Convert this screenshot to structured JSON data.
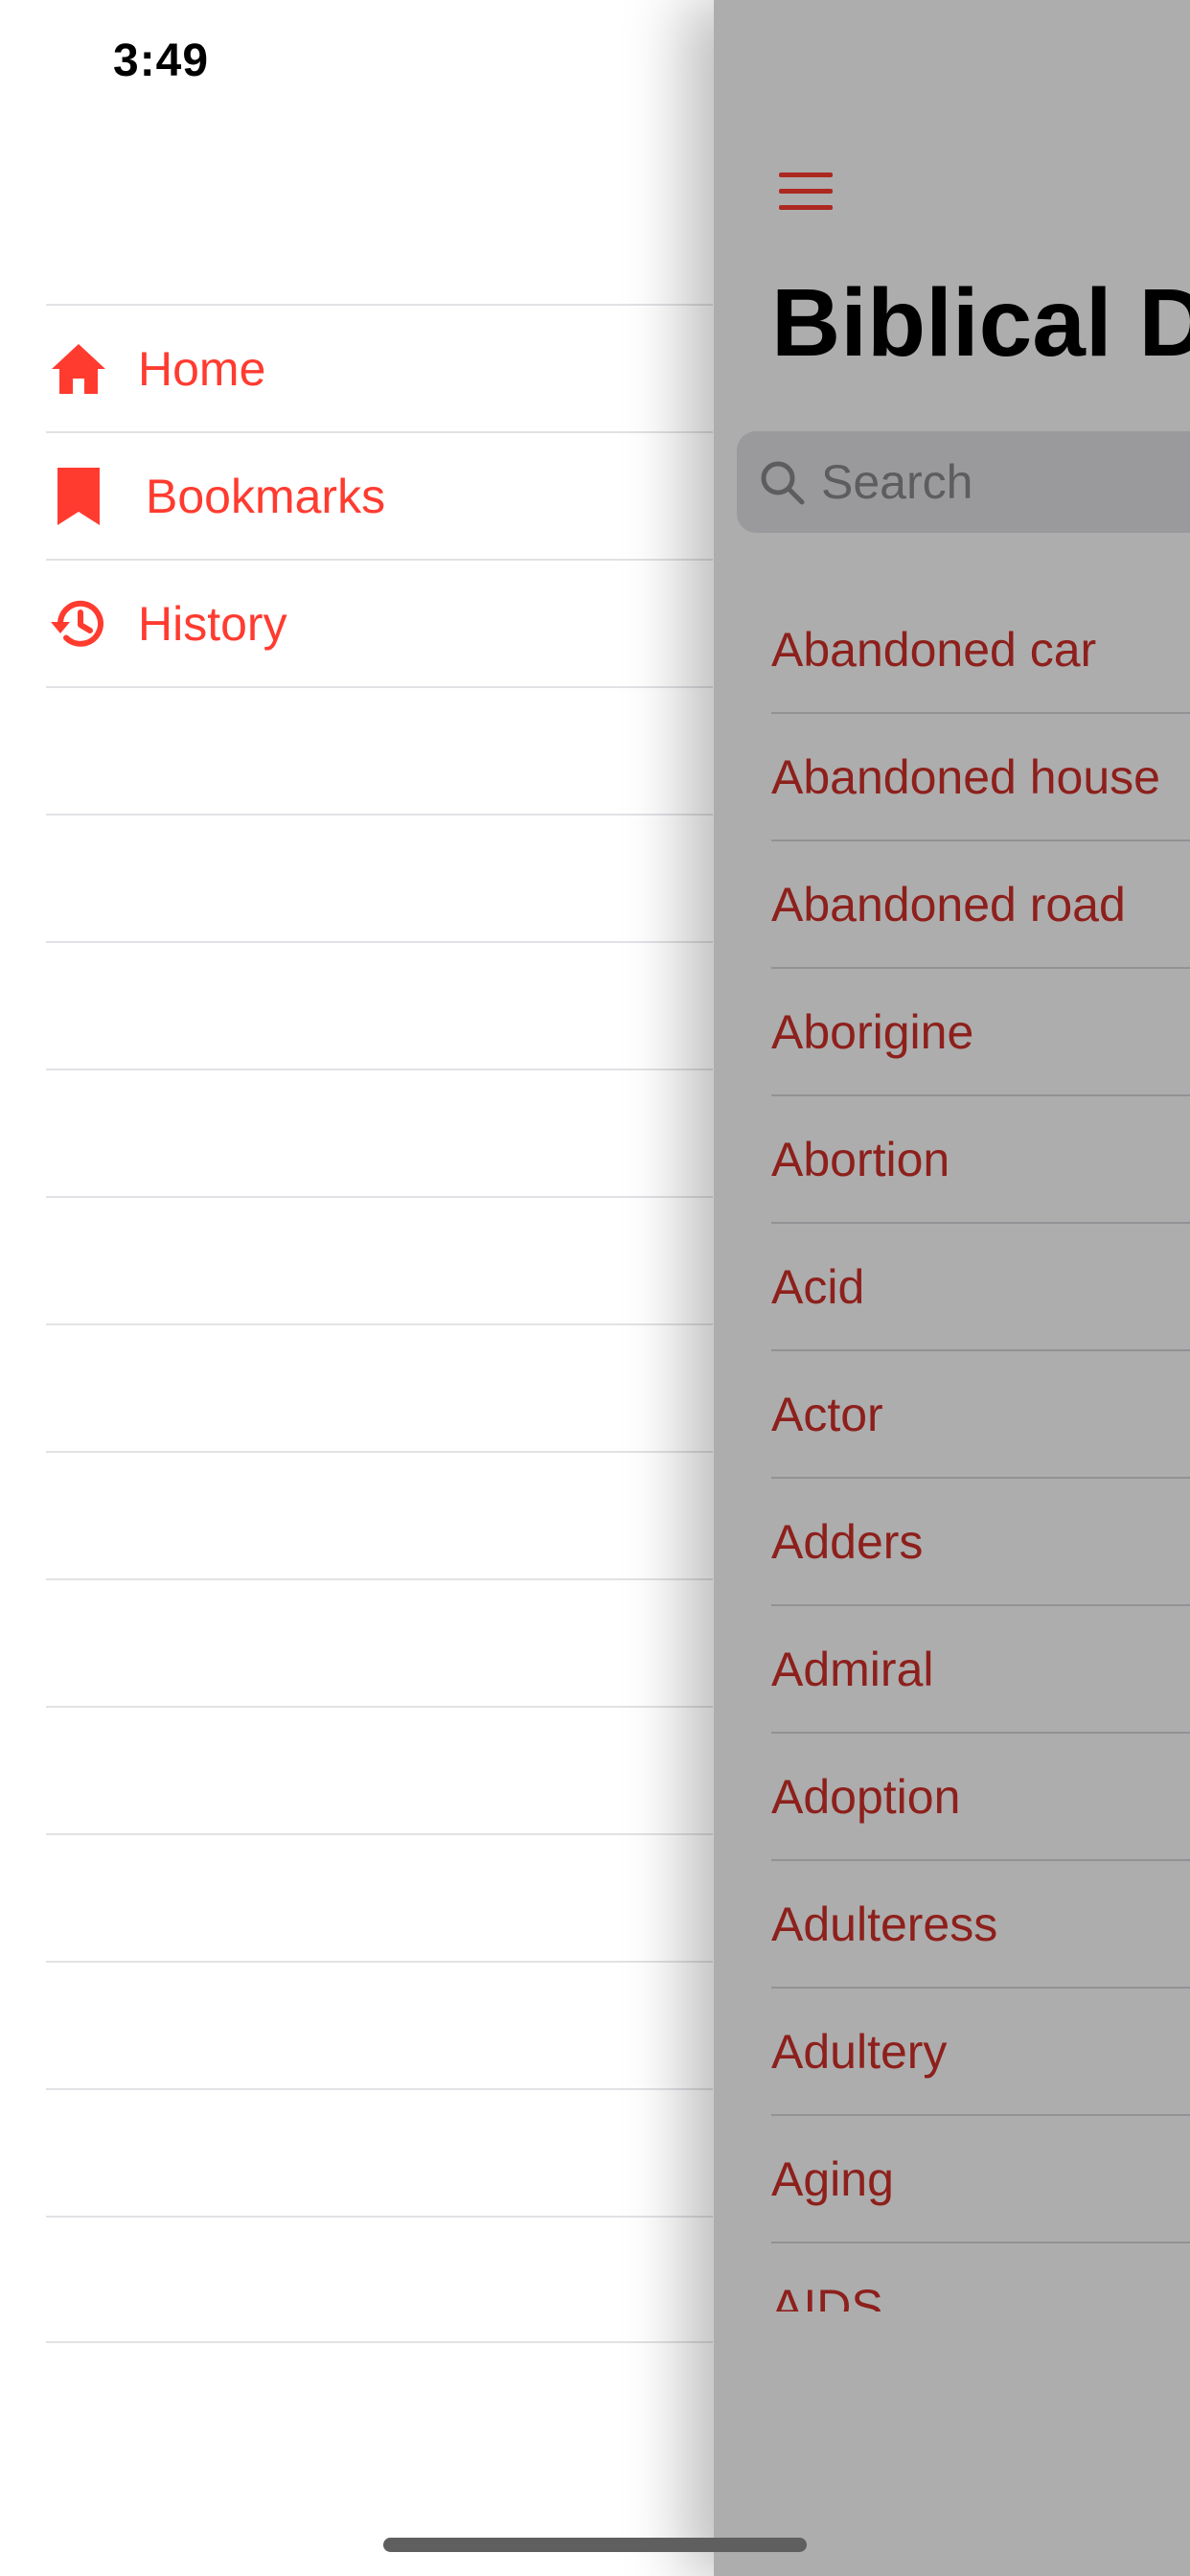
{
  "status_bar": {
    "time": "3:49"
  },
  "side_menu": {
    "items": [
      {
        "label": "Home",
        "icon": "home-icon"
      },
      {
        "label": "Bookmarks",
        "icon": "bookmark-icon"
      },
      {
        "label": "History",
        "icon": "history-icon"
      }
    ]
  },
  "main": {
    "title": "Biblical D",
    "search": {
      "placeholder": "Search"
    },
    "entries": [
      "Abandoned car",
      "Abandoned house",
      "Abandoned road",
      "Aborigine",
      "Abortion",
      "Acid",
      "Actor",
      "Adders",
      "Admiral",
      "Adoption",
      "Adulteress",
      "Adultery",
      "Aging",
      "AIDS"
    ]
  },
  "colors": {
    "accent": "#ff3b30",
    "list_text": "#d0302a",
    "overlay": "rgba(0,0,0,0.32)"
  }
}
